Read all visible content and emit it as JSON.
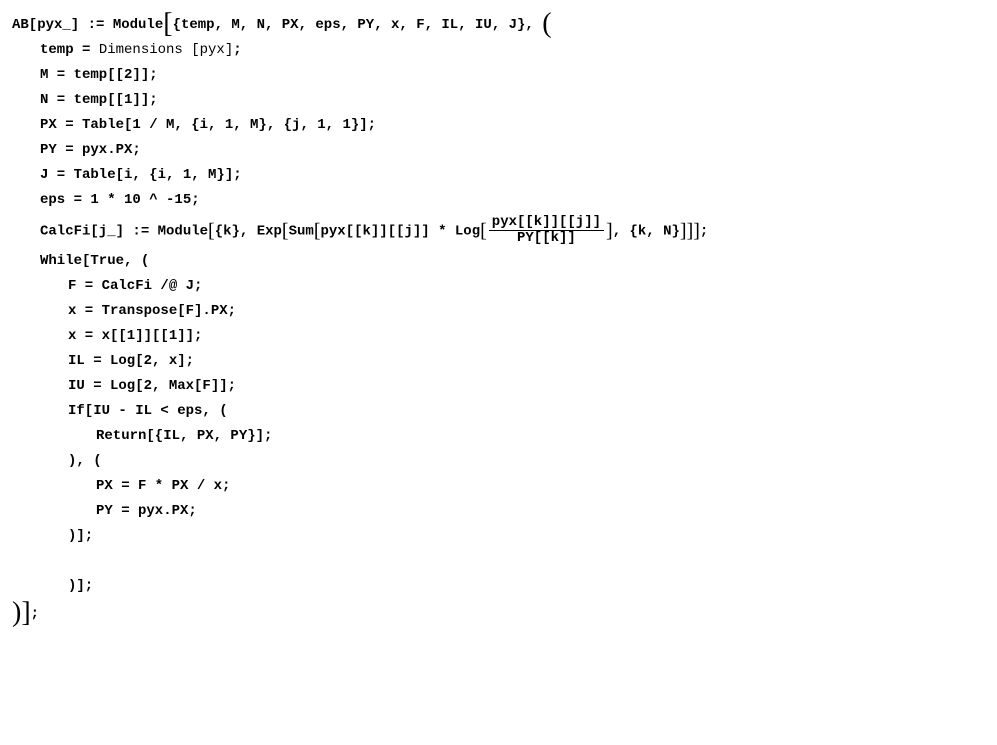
{
  "code": {
    "l01a": "AB[pyx_] := Module",
    "l01b": "{temp, M, N, PX, eps, PY, x, F, IL, IU, J}, ",
    "l02a": "temp = ",
    "l02b": "Dimensions [pyx]",
    "l02c": ";",
    "l03": "M = temp[[2]];",
    "l04": "N = temp[[1]];",
    "l05": "PX = Table[1 / M, {i, 1, M}, {j, 1, 1}];",
    "l06": "PY = pyx.PX;",
    "l07": "J = Table[i, {i, 1, M}];",
    "l08": "eps = 1 * 10 ^ -15;",
    "l09a": "CalcFi[j_] := Module",
    "l09b": "{k}, Exp",
    "l09c": "Sum",
    "l09d": "pyx[[k]][[j]] * Log",
    "l09num": "pyx[[k]][[j]]",
    "l09den": "PY[[k]]",
    "l09e": ", {k, N}",
    "l09f": ";",
    "l10": "While[True, (",
    "l11": "F = CalcFi /@ J;",
    "l12": "x = Transpose[F].PX;",
    "l13": "x = x[[1]][[1]];",
    "l14": "IL = Log[2, x];",
    "l15": "IU = Log[2, Max[F]];",
    "l16": "If[IU - IL < eps, (",
    "l17": "Return[{IL, PX, PY}];",
    "l18": "), (",
    "l19": "PX = F * PX / x;",
    "l20": "PY = pyx.PX;",
    "l21": ")];",
    "l22": ")];",
    "l23": ";"
  }
}
